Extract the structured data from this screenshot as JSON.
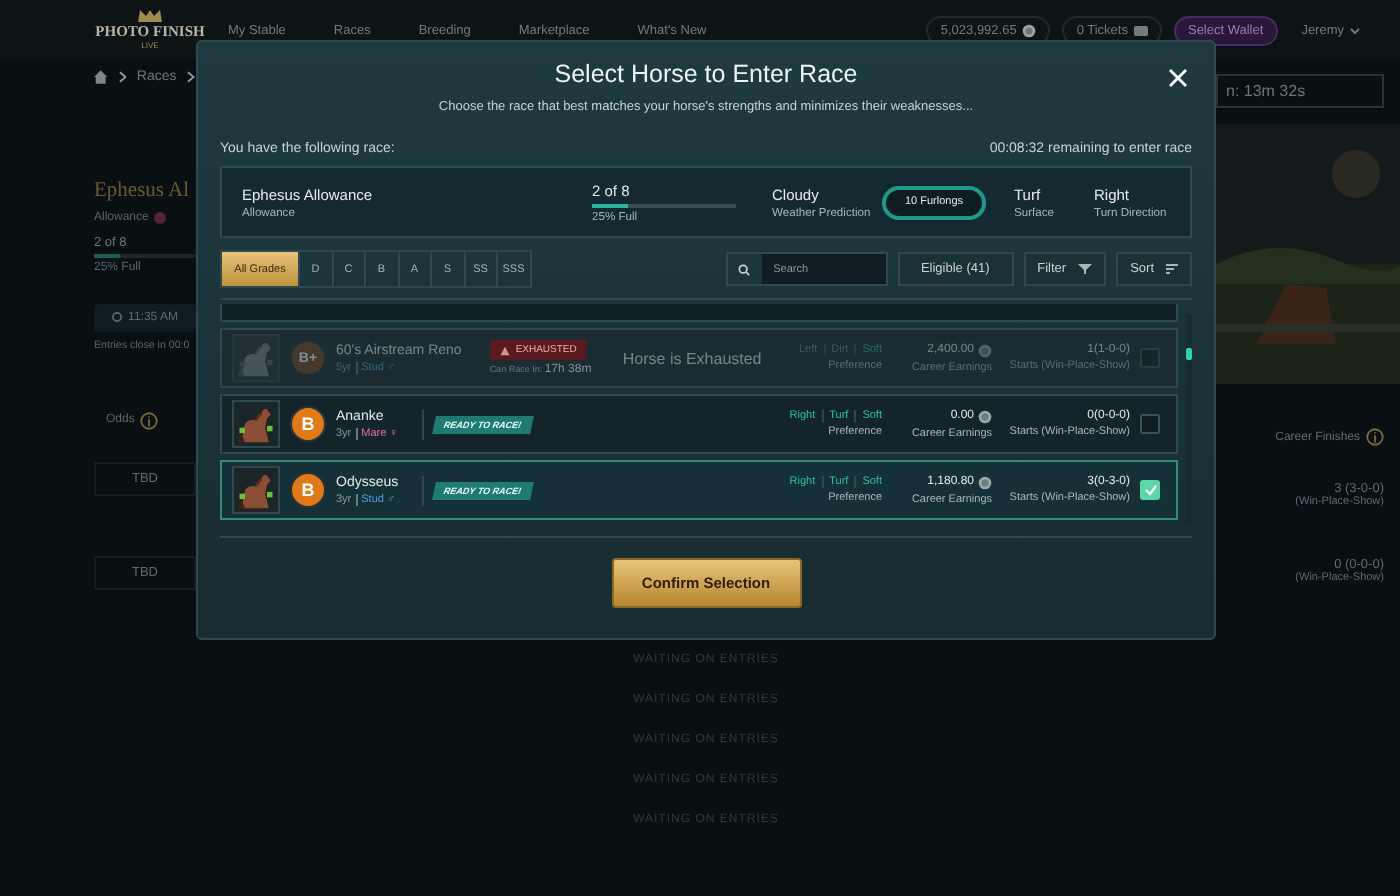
{
  "nav": {
    "logo": "PHOTO FINISH",
    "logo_sub": "LIVE",
    "links": [
      {
        "label": "My Stable"
      },
      {
        "label": "Races"
      },
      {
        "label": "Breeding"
      },
      {
        "label": "Marketplace"
      },
      {
        "label": "What's New"
      }
    ],
    "balance": "5,023,992.65",
    "tickets": "0 Tickets",
    "wallet_button": "Select Wallet",
    "user": "Jeremy"
  },
  "breadcrumb": {
    "items": [
      "Races"
    ]
  },
  "race_panel": {
    "title": "Ephesus Al",
    "type": "Allowance",
    "entries": "2 of 8",
    "level": 0.25,
    "full": "25% Full",
    "time": "11:35 AM",
    "closes": "Entries close in 00:0"
  },
  "odds": {
    "label": "Odds",
    "values": [
      "TBD",
      "TBD"
    ]
  },
  "right_panel": {
    "timer": "n: 13m 32s",
    "heading": "Career Finishes",
    "finishes": [
      {
        "value": "3 (3-0-0)",
        "caption": "(Win-Place-Show)"
      },
      {
        "value": "0 (0-0-0)",
        "caption": "(Win-Place-Show)"
      }
    ]
  },
  "waiting": [
    "WAITING ON ENTRIES",
    "WAITING ON ENTRIES",
    "WAITING ON ENTRIES",
    "WAITING ON ENTRIES",
    "WAITING ON ENTRIES"
  ],
  "modal": {
    "title": "Select Horse to Enter Race",
    "subtitle": "Choose the race that best matches your horse's strengths and minimizes their weaknesses...",
    "intro": "You have the following race:",
    "countdown": "00:08:32 remaining to enter race",
    "race": {
      "name": "Ephesus Allowance",
      "type": "Allowance",
      "entries": "2 of 8",
      "level": 0.25,
      "full": "25% Full",
      "weather": "Cloudy",
      "weather_label": "Weather Prediction",
      "distance": "10 Furlongs",
      "surface": "Turf",
      "surface_label": "Surface",
      "direction": "Right",
      "direction_label": "Turn Direction"
    },
    "grades": [
      {
        "label": "All Grades",
        "selected": true
      },
      {
        "label": "D",
        "selected": false
      },
      {
        "label": "C",
        "selected": false
      },
      {
        "label": "B",
        "selected": false
      },
      {
        "label": "A",
        "selected": false
      },
      {
        "label": "S",
        "selected": false
      },
      {
        "label": "SS",
        "selected": false
      },
      {
        "label": "SSS",
        "selected": false
      }
    ],
    "search": {
      "placeholder": "Search"
    },
    "eligible_button": "Eligible (41)",
    "filter_button": "Filter",
    "sort_button": "Sort",
    "horses": [
      {
        "kind": "exhausted",
        "name": "60's Airstream Reno",
        "grade": "B+",
        "age": "5yr",
        "sex": {
          "kind": "stud",
          "label": "Stud",
          "symbol": "♂"
        },
        "status": "EXHAUSTED",
        "can_race_label": "Can Race In:",
        "can_race_time": "17h 38m",
        "notice": "Horse is Exhausted",
        "prefs": [
          {
            "label": "Left",
            "match": false
          },
          {
            "label": "Dirt",
            "match": false
          },
          {
            "label": "Soft",
            "match": true
          }
        ],
        "pref_label": "Preference",
        "earnings": "2,400.00",
        "earnings_label": "Career Earnings",
        "starts": "1(1-0-0)",
        "starts_label": "Starts (Win-Place-Show)",
        "selected": false
      },
      {
        "kind": "ready",
        "name": "Ananke",
        "grade": "B",
        "age": "3yr",
        "sex": {
          "kind": "mare",
          "label": "Mare",
          "symbol": "♀"
        },
        "status": "READY TO RACE!",
        "prefs": [
          {
            "label": "Right",
            "match": true
          },
          {
            "label": "Turf",
            "match": true
          },
          {
            "label": "Soft",
            "match": true
          }
        ],
        "pref_label": "Preference",
        "earnings": "0.00",
        "earnings_label": "Career Earnings",
        "starts": "0(0-0-0)",
        "starts_label": "Starts (Win-Place-Show)",
        "selected": false
      },
      {
        "kind": "ready",
        "name": "Odysseus",
        "grade": "B",
        "age": "3yr",
        "sex": {
          "kind": "stud",
          "label": "Stud",
          "symbol": "♂"
        },
        "status": "READY TO RACE!",
        "prefs": [
          {
            "label": "Right",
            "match": true
          },
          {
            "label": "Turf",
            "match": true
          },
          {
            "label": "Soft",
            "match": true
          }
        ],
        "pref_label": "Preference",
        "earnings": "1,180.80",
        "earnings_label": "Career Earnings",
        "starts": "3(0-3-0)",
        "starts_label": "Starts (Win-Place-Show)",
        "selected": true
      }
    ],
    "confirm_button": "Confirm Selection"
  }
}
